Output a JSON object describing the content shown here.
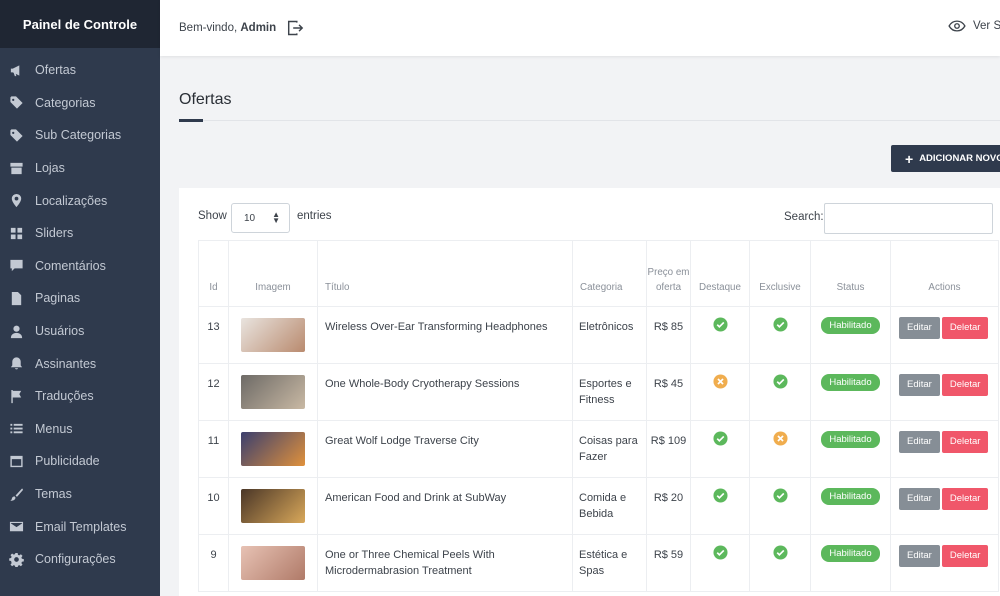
{
  "sidebar": {
    "brand": "Painel de Controle",
    "items": [
      {
        "label": "Ofertas",
        "icon": "megaphone-icon"
      },
      {
        "label": "Categorias",
        "icon": "tag-icon"
      },
      {
        "label": "Sub Categorias",
        "icon": "tag-icon"
      },
      {
        "label": "Lojas",
        "icon": "store-icon"
      },
      {
        "label": "Localizações",
        "icon": "map-pin-icon"
      },
      {
        "label": "Sliders",
        "icon": "grid-icon"
      },
      {
        "label": "Comentários",
        "icon": "comment-icon"
      },
      {
        "label": "Paginas",
        "icon": "file-icon"
      },
      {
        "label": "Usuários",
        "icon": "user-icon"
      },
      {
        "label": "Assinantes",
        "icon": "bell-icon"
      },
      {
        "label": "Traduções",
        "icon": "flag-icon"
      },
      {
        "label": "Menus",
        "icon": "list-icon"
      },
      {
        "label": "Publicidade",
        "icon": "window-icon"
      },
      {
        "label": "Temas",
        "icon": "brush-icon"
      },
      {
        "label": "Email Templates",
        "icon": "envelope-icon"
      },
      {
        "label": "Configurações",
        "icon": "gear-icon"
      }
    ]
  },
  "topbar": {
    "welcome_prefix": "Bem-vindo,",
    "user": "Admin",
    "view_site": "Ver Site"
  },
  "page": {
    "title": "Ofertas",
    "add_button": "ADICIONAR NOVO"
  },
  "table_controls": {
    "show_label": "Show",
    "entries_value": "10",
    "entries_label": "entries",
    "search_label": "Search:"
  },
  "columns": {
    "id": "Id",
    "image": "Imagem",
    "title": "Título",
    "category": "Categoria",
    "price": "Preço em oferta",
    "featured": "Destaque",
    "exclusive": "Exclusive",
    "status": "Status",
    "actions": "Actions"
  },
  "rows": [
    {
      "id": "13",
      "title": "Wireless Over-Ear Transforming Headphones",
      "category": "Eletrônicos",
      "price": "R$ 85",
      "featured": true,
      "exclusive": true,
      "status": "Habilitado",
      "thumb_colors": [
        "#e9e4df",
        "#b98a6e"
      ]
    },
    {
      "id": "12",
      "title": "One Whole-Body Cryotherapy Sessions",
      "category": "Esportes e Fitness",
      "price": "R$ 45",
      "featured": false,
      "exclusive": true,
      "status": "Habilitado",
      "thumb_colors": [
        "#6d6a66",
        "#c9b9a4"
      ]
    },
    {
      "id": "11",
      "title": "Great Wolf Lodge Traverse City",
      "category": "Coisas para Fazer",
      "price": "R$ 109",
      "featured": true,
      "exclusive": false,
      "status": "Habilitado",
      "thumb_colors": [
        "#3b3f6e",
        "#e0913c"
      ]
    },
    {
      "id": "10",
      "title": "American Food and Drink at SubWay",
      "category": "Comida e Bebida",
      "price": "R$ 20",
      "featured": true,
      "exclusive": true,
      "status": "Habilitado",
      "thumb_colors": [
        "#4a3627",
        "#d9a85a"
      ]
    },
    {
      "id": "9",
      "title": "One or Three Chemical Peels With Microdermabrasion Treatment",
      "category": "Estética e Spas",
      "price": "R$ 59",
      "featured": true,
      "exclusive": true,
      "status": "Habilitado",
      "thumb_colors": [
        "#e7c2b4",
        "#b07a68"
      ]
    }
  ],
  "action_labels": {
    "edit": "Editar",
    "delete": "Deletar"
  },
  "colors": {
    "sidebar": "#2f3a4d",
    "brand_bar": "#1f2633",
    "success": "#5cb85c",
    "warning": "#f0ad4e",
    "danger": "#f0576a",
    "edit": "#868e96"
  }
}
